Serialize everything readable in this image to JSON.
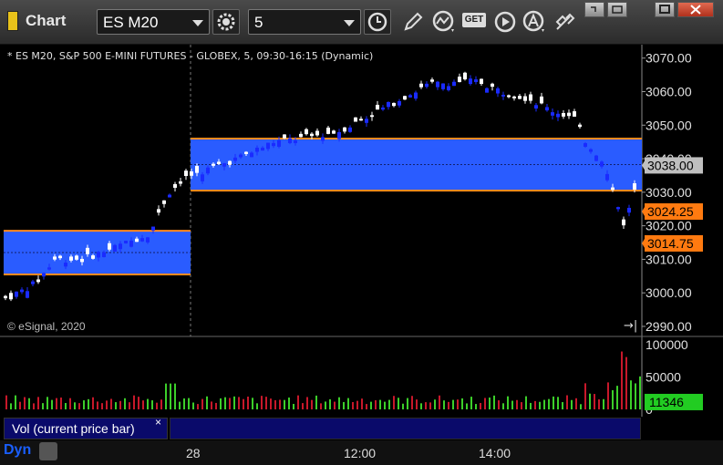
{
  "toolbar": {
    "app_title": "Chart",
    "symbol": "ES M20",
    "interval": "5",
    "get_label": "GET"
  },
  "chart": {
    "title": "* ES M20, S&P 500 E-MINI FUTURES - GLOBEX, 5, 09:30-16:15 (Dynamic)",
    "copyright": "© eSignal, 2020",
    "price_ticks": [
      "3070.00",
      "3060.00",
      "3050.00",
      "3040.00",
      "3030.00",
      "3020.00",
      "3010.00",
      "3000.00",
      "2990.00"
    ],
    "price_tick_values": [
      3070,
      3060,
      3050,
      3040,
      3030,
      3020,
      3010,
      3000,
      2990
    ],
    "last_price_label": "3038.00",
    "marker_1_label": "3024.25",
    "marker_2_label": "3014.75",
    "volume_ticks": [
      "100000",
      "50000",
      "0"
    ],
    "volume_last_label": "11346",
    "pane_label": "Vol (current price bar)",
    "pane_close": "×",
    "dyn_label": "Dyn",
    "time_labels": [
      "28",
      "12:00",
      "14:00"
    ]
  },
  "chart_data": {
    "type": "candlestick",
    "price_range": [
      2987,
      3074
    ],
    "zones": [
      {
        "from": 3005.5,
        "to": 3018.5
      },
      {
        "from": 3030.5,
        "to": 3046.0
      }
    ],
    "levels": [
      3038.0,
      3024.25,
      3014.75
    ],
    "colors": {
      "zone": "#2a5cff",
      "zone_border": "#ff8a1e",
      "up": "#ffffff",
      "down": "#1a2bff",
      "vol_up": "#3ccf2a",
      "vol_down": "#c8182a",
      "marker": "#ff7a10",
      "last": "#bfbfbf",
      "vol_last": "#22cc22"
    }
  }
}
